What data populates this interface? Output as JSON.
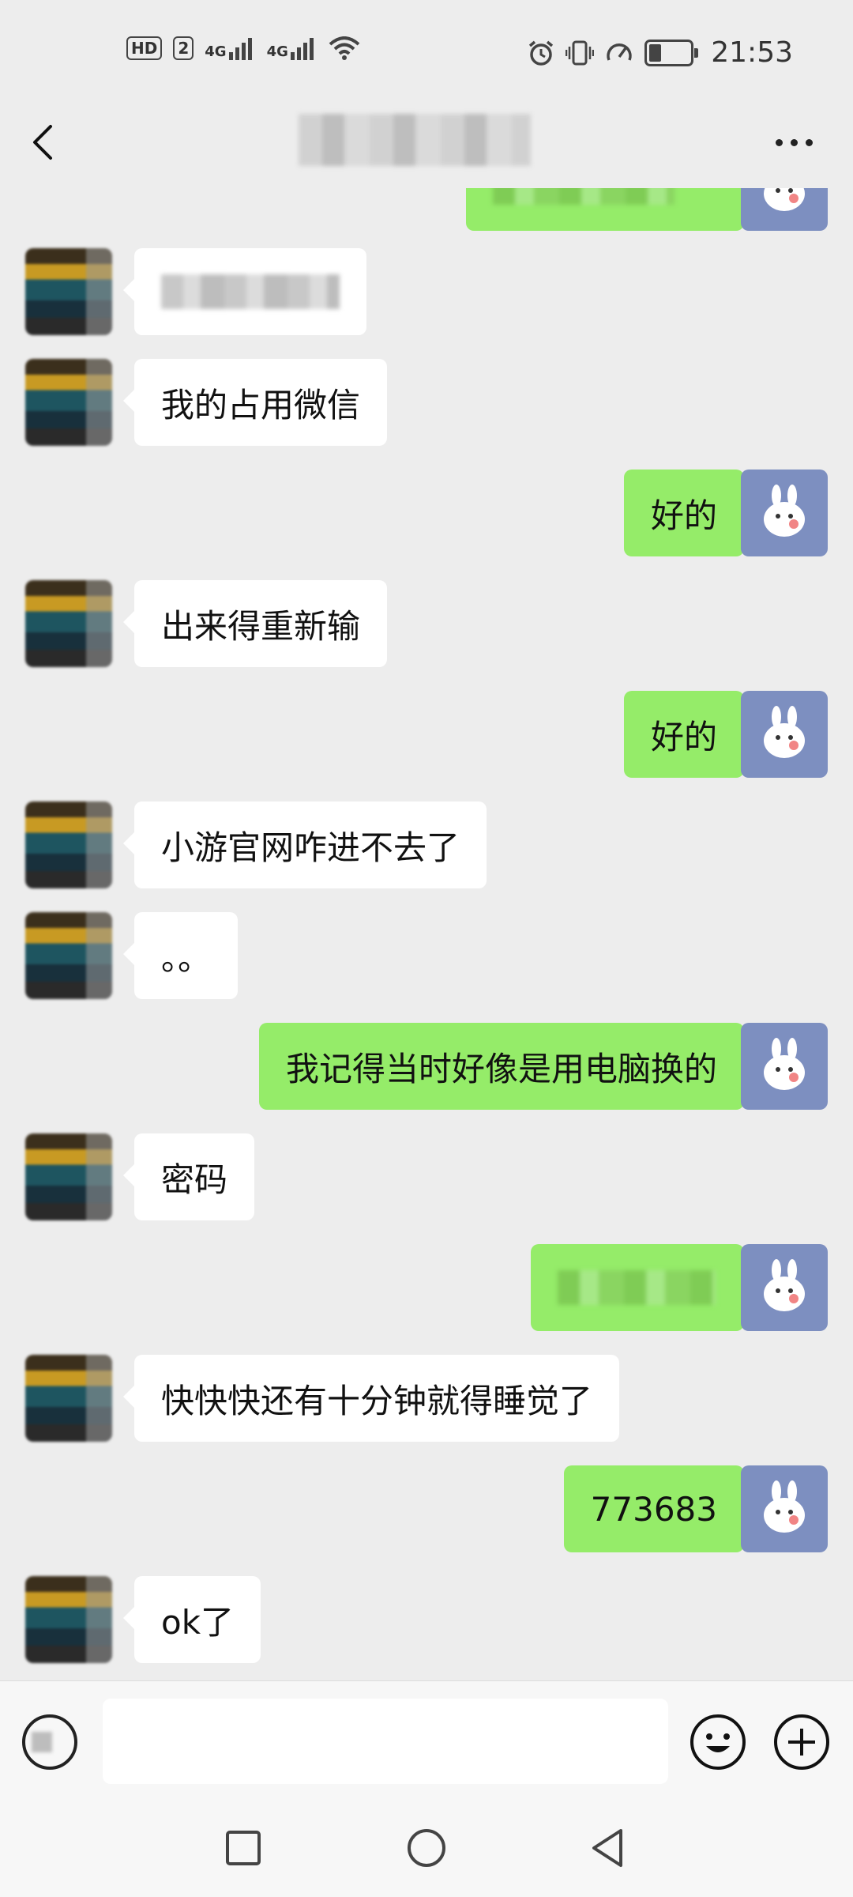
{
  "status_bar": {
    "hd_label": "HD",
    "sim_label": "2",
    "signal1_label": "4G",
    "signal2_label": "4G",
    "time": "21:53",
    "icons": [
      "signal-icon",
      "wifi-icon",
      "alarm-icon",
      "vibrate-icon",
      "speed-icon",
      "battery-icon"
    ],
    "battery_level": 0.3
  },
  "header": {
    "title": "",
    "back_icon": "chevron-left-icon",
    "more_icon": "more-icon"
  },
  "messages": [
    {
      "sender": "me",
      "text": "",
      "blurred": true
    },
    {
      "sender": "other",
      "text": "",
      "blurred": true
    },
    {
      "sender": "other",
      "text": "我的占用微信"
    },
    {
      "sender": "me",
      "text": "好的"
    },
    {
      "sender": "other",
      "text": "出来得重新输"
    },
    {
      "sender": "me",
      "text": "好的"
    },
    {
      "sender": "other",
      "text": "小游官网咋进不去了"
    },
    {
      "sender": "other",
      "text": "。。"
    },
    {
      "sender": "me",
      "text": "我记得当时好像是用电脑换的"
    },
    {
      "sender": "other",
      "text": "密码"
    },
    {
      "sender": "me",
      "text": "",
      "blurred": true
    },
    {
      "sender": "other",
      "text": "快快快还有十分钟就得睡觉了"
    },
    {
      "sender": "me",
      "text": "773683"
    },
    {
      "sender": "other",
      "text": "ok了"
    }
  ],
  "input_bar": {
    "placeholder": "",
    "icons": [
      "voice-icon",
      "emoji-icon",
      "plus-icon"
    ]
  },
  "nav_bar": {
    "icons": [
      "recent-apps-icon",
      "home-icon",
      "back-icon"
    ]
  },
  "colors": {
    "background": "#ededed",
    "my_bubble": "#95ec69",
    "their_bubble": "#ffffff",
    "my_avatar": "#7d8fc0"
  }
}
